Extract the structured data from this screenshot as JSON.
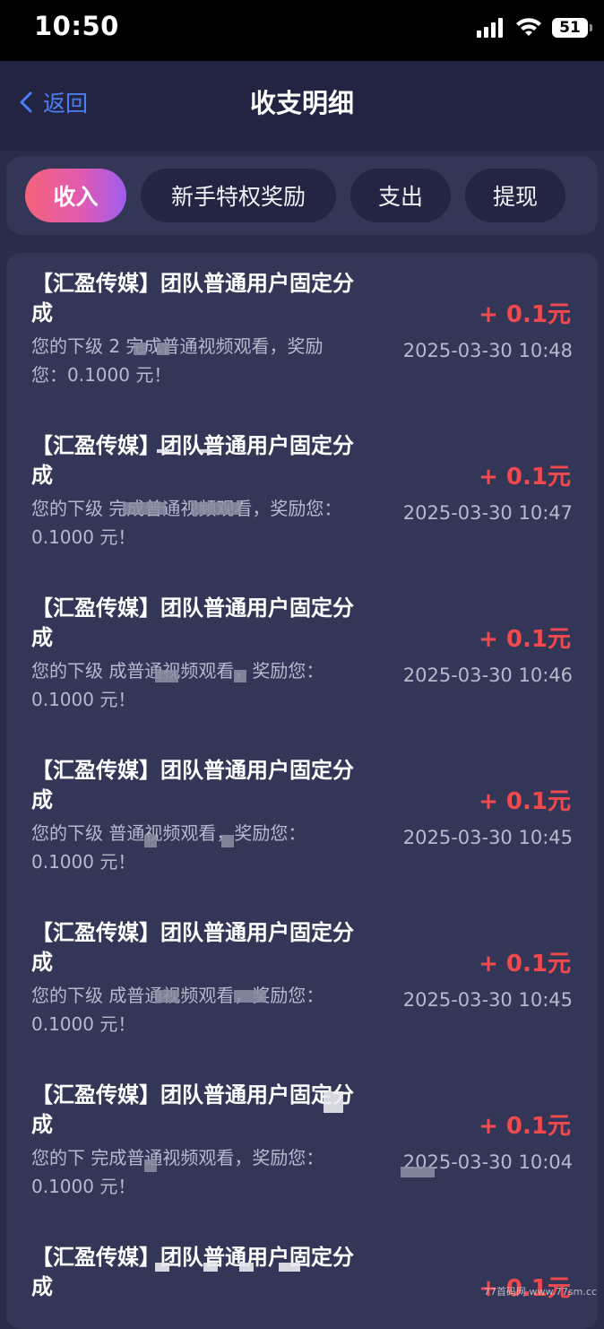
{
  "status_bar": {
    "time": "10:50",
    "battery": "51",
    "icons": [
      "signal-icon",
      "wifi-icon",
      "battery-icon"
    ]
  },
  "header": {
    "back_label": "返回",
    "title": "收支明细"
  },
  "tabs": [
    {
      "label": "收入",
      "active": true
    },
    {
      "label": "新手特权奖励",
      "active": false
    },
    {
      "label": "支出",
      "active": false
    },
    {
      "label": "提现",
      "active": false
    }
  ],
  "records": [
    {
      "title": "【汇盈传媒】团队普通用户固定分成",
      "desc": "您的下级 2 完成普通视频观看，奖励您：0.1000 元！",
      "amount": "+ 0.1元",
      "time": "2025-03-30 10:48"
    },
    {
      "title": "【汇盈传媒】团队普通用户固定分成",
      "desc": "您的下级 完成普通视频观看，奖励您：0.1000 元！",
      "amount": "+ 0.1元",
      "time": "2025-03-30 10:47"
    },
    {
      "title": "【汇盈传媒】团队普通用户固定分成",
      "desc": "您的下级 成普通视频观看，奖励您：0.1000 元！",
      "amount": "+ 0.1元",
      "time": "2025-03-30 10:46"
    },
    {
      "title": "【汇盈传媒】团队普通用户固定分成",
      "desc": "您的下级 普通视频观看，奖励您：0.1000 元！",
      "amount": "+ 0.1元",
      "time": "2025-03-30 10:45"
    },
    {
      "title": "【汇盈传媒】团队普通用户固定分成",
      "desc": "您的下级 成普通视频观看，奖励您：0.1000 元！",
      "amount": "+ 0.1元",
      "time": "2025-03-30 10:45"
    },
    {
      "title": "【汇盈传媒】团队普通用户固定分成",
      "desc": "您的下 完成普通视频观看，奖励您：0.1000 元！",
      "amount": "+ 0.1元",
      "time": "2025-03-30 10:04"
    },
    {
      "title": "【汇盈传媒】团队普通用户固定分成",
      "desc": "",
      "amount": "+ 0.1元",
      "time": ""
    }
  ],
  "colors": {
    "background": "#2a2c4b",
    "panel": "#333657",
    "accent_blue": "#4a7ff5",
    "amount_red": "#f0494e",
    "tab_gradient_start": "#f5637a",
    "tab_gradient_end": "#9f5cf0"
  },
  "watermark": "77首码网 www.77sm.cc"
}
